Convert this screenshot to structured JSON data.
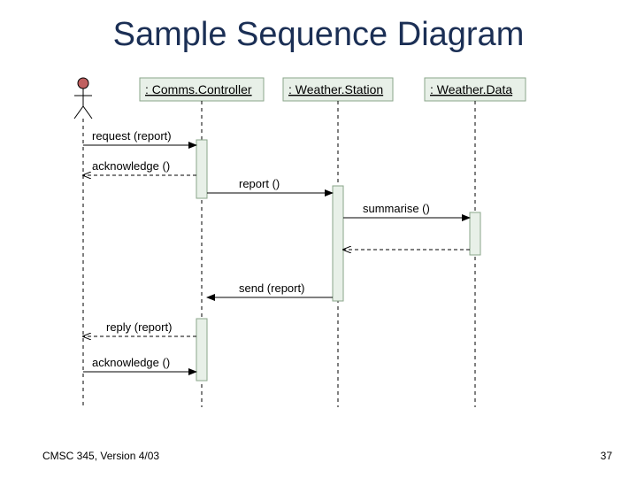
{
  "title": "Sample Sequence Diagram",
  "footer_left": "CMSC 345, Version 4/03",
  "footer_right": "37",
  "participants": {
    "actor": "",
    "p1": ": Comms.Controller",
    "p2": ": Weather.Station",
    "p3": ": Weather.Data"
  },
  "messages": {
    "m1": "request (report)",
    "m2": "acknowledge ()",
    "m3": "report ()",
    "m4": "summarise ()",
    "m5": "send (report)",
    "m6": "reply (report)",
    "m7": "acknowledge ()"
  }
}
